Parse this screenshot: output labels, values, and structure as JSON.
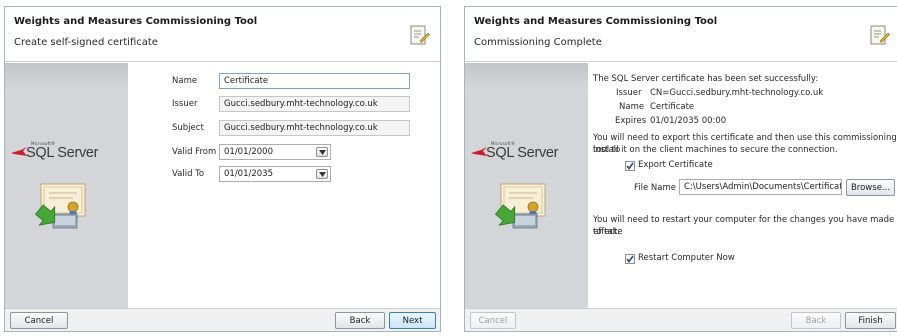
{
  "left_window": {
    "title": "Weights and Measures Commissioning Tool",
    "subtitle": "Create self-signed certificate",
    "logo": {
      "brand": "Microsoft®",
      "product": "SQL Server"
    },
    "form": {
      "name_label": "Name",
      "name_value": "Certificate",
      "issuer_label": "Issuer",
      "issuer_value": "Gucci.sedbury.mht-technology.co.uk",
      "subject_label": "Subject",
      "subject_value": "Gucci.sedbury.mht-technology.co.uk",
      "valid_from_label": "Valid From",
      "valid_from_value": "01/01/2000",
      "valid_to_label": "Valid To",
      "valid_to_value": "01/01/2035"
    },
    "footer": {
      "cancel_label": "Cancel",
      "back_label": "Back",
      "next_label": "Next"
    }
  },
  "right_window": {
    "title": "Weights and Measures Commissioning Tool",
    "subtitle": "Commissioning Complete",
    "logo": {
      "brand": "Microsoft®",
      "product": "SQL Server"
    },
    "content": {
      "success_text": "The SQL Server certificate has been set successfully:",
      "issuer_label": "Issuer",
      "issuer_value": "CN=Gucci.sedbury.mht-technology.co.uk",
      "name_label": "Name",
      "name_value": "Certificate",
      "expires_label": "Expires",
      "expires_value": "01/01/2035 00:00",
      "export_text_line1": "You will need to export this certificate and then use this commissioning tool to",
      "export_text_line2": "install it on the client machines to secure the connection.",
      "export_checkbox_label": "Export Certificate",
      "export_checked": true,
      "file_name_label": "File Name",
      "file_name_value": "C:\\Users\\Admin\\Documents\\Certificate.ce",
      "browse_label": "Browse...",
      "restart_text_line1": "You will need to restart your computer for the changes you have made to take",
      "restart_text_line2": "effect.",
      "restart_checkbox_label": "Restart Computer Now",
      "restart_checked": true
    },
    "footer": {
      "cancel_label": "Cancel",
      "back_label": "Back",
      "finish_label": "Finish"
    }
  },
  "colors": {
    "border": "#a9b3c0",
    "sidebar_bg": "#d4d5d8",
    "footer_bg": "#f0f0f0",
    "primary_button_border": "#3c7fb1",
    "check_mark": "#2b4a8c"
  },
  "icons": [
    "wizard-header-icon",
    "sql-server-logo",
    "certificate-icon",
    "dropdown-arrow-icon",
    "checkbox-check-icon"
  ]
}
